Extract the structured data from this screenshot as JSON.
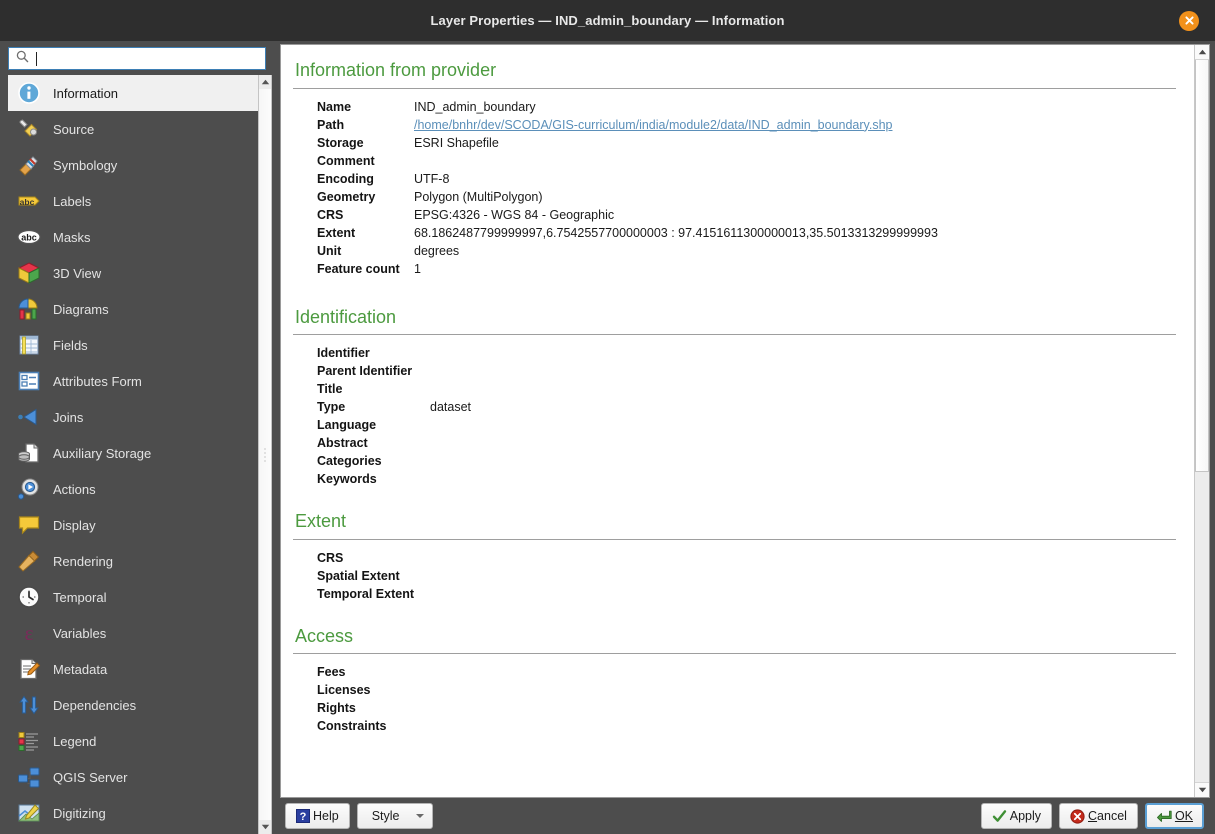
{
  "window": {
    "title": "Layer Properties — IND_admin_boundary — Information",
    "close_icon": "close-icon"
  },
  "search": {
    "value": "",
    "placeholder": "",
    "icon": "search-icon"
  },
  "sidebar": {
    "items": [
      {
        "label": "Information",
        "icon": "information-icon",
        "selected": true
      },
      {
        "label": "Source",
        "icon": "source-wrench-icon",
        "selected": false
      },
      {
        "label": "Symbology",
        "icon": "symbology-brush-icon",
        "selected": false
      },
      {
        "label": "Labels",
        "icon": "labels-abc-icon",
        "selected": false
      },
      {
        "label": "Masks",
        "icon": "masks-abc-cloud-icon",
        "selected": false
      },
      {
        "label": "3D View",
        "icon": "cube-3d-icon",
        "selected": false
      },
      {
        "label": "Diagrams",
        "icon": "diagrams-chart-icon",
        "selected": false
      },
      {
        "label": "Fields",
        "icon": "fields-table-icon",
        "selected": false
      },
      {
        "label": "Attributes Form",
        "icon": "attributes-form-icon",
        "selected": false
      },
      {
        "label": "Joins",
        "icon": "joins-arrow-icon",
        "selected": false
      },
      {
        "label": "Auxiliary Storage",
        "icon": "auxiliary-storage-icon",
        "selected": false
      },
      {
        "label": "Actions",
        "icon": "actions-gear-icon",
        "selected": false
      },
      {
        "label": "Display",
        "icon": "display-balloon-icon",
        "selected": false
      },
      {
        "label": "Rendering",
        "icon": "rendering-broom-icon",
        "selected": false
      },
      {
        "label": "Temporal",
        "icon": "temporal-clock-icon",
        "selected": false
      },
      {
        "label": "Variables",
        "icon": "variables-epsilon-icon",
        "selected": false
      },
      {
        "label": "Metadata",
        "icon": "metadata-pencil-icon",
        "selected": false
      },
      {
        "label": "Dependencies",
        "icon": "dependencies-arrows-icon",
        "selected": false
      },
      {
        "label": "Legend",
        "icon": "legend-swatches-icon",
        "selected": false
      },
      {
        "label": "QGIS Server",
        "icon": "qgis-server-icon",
        "selected": false
      },
      {
        "label": "Digitizing",
        "icon": "digitizing-pencil-map-icon",
        "selected": false
      }
    ]
  },
  "content": {
    "sections": [
      {
        "id": "information-from-provider",
        "title": "Information from provider",
        "rows": [
          {
            "key": "Name",
            "value": "IND_admin_boundary",
            "link": false
          },
          {
            "key": "Path",
            "value": "/home/bnhr/dev/SCODA/GIS-curriculum/india/module2/data/IND_admin_boundary.shp",
            "link": true
          },
          {
            "key": "Storage",
            "value": "ESRI Shapefile",
            "link": false
          },
          {
            "key": "Comment",
            "value": "",
            "link": false
          },
          {
            "key": "Encoding",
            "value": "UTF-8",
            "link": false
          },
          {
            "key": "Geometry",
            "value": "Polygon (MultiPolygon)",
            "link": false
          },
          {
            "key": "CRS",
            "value": "EPSG:4326 - WGS 84 - Geographic",
            "link": false
          },
          {
            "key": "Extent",
            "value": "68.1862487799999997,6.7542557700000003 : 97.4151611300000013,35.5013313299999993",
            "link": false
          },
          {
            "key": "Unit",
            "value": "degrees",
            "link": false
          },
          {
            "key": "Feature count",
            "value": "1",
            "link": false
          }
        ]
      },
      {
        "id": "identification",
        "title": "Identification",
        "rows": [
          {
            "key": "Identifier",
            "value": "",
            "link": false
          },
          {
            "key": "Parent Identifier",
            "value": "",
            "link": false
          },
          {
            "key": "Title",
            "value": "",
            "link": false
          },
          {
            "key": "Type",
            "value": "dataset",
            "link": false
          },
          {
            "key": "Language",
            "value": "",
            "link": false
          },
          {
            "key": "Abstract",
            "value": "",
            "link": false
          },
          {
            "key": "Categories",
            "value": "",
            "link": false
          },
          {
            "key": "Keywords",
            "value": "",
            "link": false
          }
        ]
      },
      {
        "id": "extent",
        "title": "Extent",
        "rows": [
          {
            "key": "CRS",
            "value": "",
            "link": false
          },
          {
            "key": "Spatial Extent",
            "value": "",
            "link": false
          },
          {
            "key": "Temporal Extent",
            "value": "",
            "link": false
          }
        ]
      },
      {
        "id": "access",
        "title": "Access",
        "rows": [
          {
            "key": "Fees",
            "value": "",
            "link": false
          },
          {
            "key": "Licenses",
            "value": "",
            "link": false
          },
          {
            "key": "Rights",
            "value": "",
            "link": false
          },
          {
            "key": "Constraints",
            "value": "",
            "link": false
          }
        ]
      }
    ]
  },
  "buttons": {
    "help": "Help",
    "style": "Style",
    "apply": "Apply",
    "cancel_pre": "",
    "cancel_key": "C",
    "cancel_post": "ancel",
    "ok_key": "OK"
  },
  "colors": {
    "accent_green": "#4c9a3f",
    "link_blue": "#5b8fb9",
    "titlebar": "#2e2e2e",
    "sidebar": "#4d4d4d",
    "selected_row": "#f0f0f0",
    "close_orange": "#f2911b",
    "focus_blue": "#5a9fd4"
  }
}
